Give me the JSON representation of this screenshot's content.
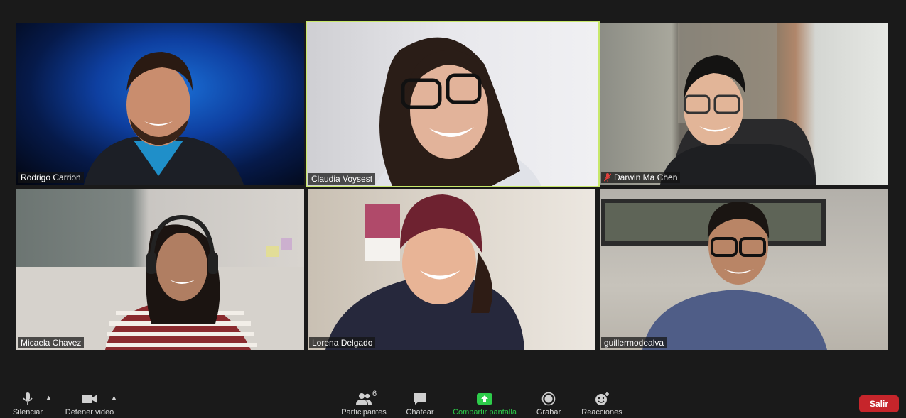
{
  "participants": [
    {
      "name": "Rodrigo Carrion",
      "muted": false,
      "active": false
    },
    {
      "name": "Claudia Voysest",
      "muted": false,
      "active": true
    },
    {
      "name": "Darwin Ma Chen",
      "muted": true,
      "active": false
    },
    {
      "name": "Micaela Chavez",
      "muted": false,
      "active": false
    },
    {
      "name": "Lorena Delgado",
      "muted": false,
      "active": false
    },
    {
      "name": "guillermodealva",
      "muted": false,
      "active": false
    }
  ],
  "toolbar": {
    "mute_label": "Silenciar",
    "video_label": "Detener video",
    "participants_label": "Participantes",
    "participants_count": "6",
    "chat_label": "Chatear",
    "share_label": "Compartir pantalla",
    "record_label": "Grabar",
    "reactions_label": "Reacciones",
    "leave_label": "Salir"
  },
  "colors": {
    "active_speaker_border": "#c8e86b",
    "share_green": "#2dcc4a",
    "leave_red": "#c6252b",
    "muted_icon_red": "#e0403c"
  },
  "icons": [
    "microphone-icon",
    "video-camera-icon",
    "participants-icon",
    "chat-icon",
    "share-screen-icon",
    "record-icon",
    "reactions-icon",
    "muted-microphone-icon"
  ]
}
